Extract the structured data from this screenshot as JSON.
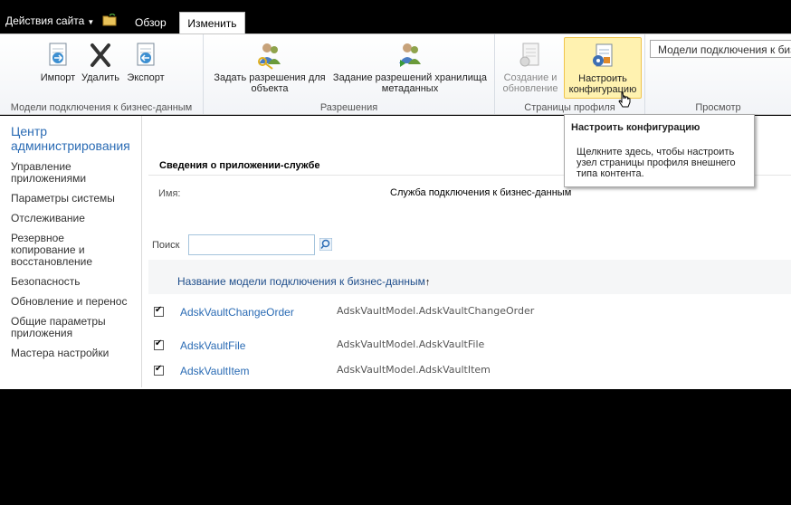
{
  "topbar": {
    "site_actions": "Действия сайта",
    "tabs": [
      {
        "label": "Обзор"
      },
      {
        "label": "Изменить"
      }
    ]
  },
  "ribbon": {
    "groups": [
      {
        "label": "Модели подключения к бизнес-данным",
        "buttons": [
          {
            "label": "Импорт",
            "icon": "import-icon"
          },
          {
            "label": "Удалить",
            "icon": "delete-icon"
          },
          {
            "label": "Экспорт",
            "icon": "export-icon"
          }
        ]
      },
      {
        "label": "Разрешения",
        "buttons": [
          {
            "line1": "Задать разрешения для",
            "line2": "объекта",
            "icon": "object-permissions-icon"
          },
          {
            "line1": "Задание разрешений хранилища",
            "line2": "метаданных",
            "icon": "metadata-store-permissions-icon"
          }
        ]
      },
      {
        "label": "Страницы профиля",
        "buttons": [
          {
            "line1": "Создание и",
            "line2": "обновление",
            "icon": "create-update-icon"
          },
          {
            "line1": "Настроить",
            "line2": "конфигурацию",
            "icon": "configure-icon"
          }
        ]
      },
      {
        "label": "Просмотр",
        "combo_value": "Модели подключения к биз"
      }
    ]
  },
  "quicklaunch": {
    "title_line1": "Центр",
    "title_line2": "администрирования",
    "items": [
      {
        "line1": "Управление",
        "line2": "приложениями"
      },
      {
        "line1": "Параметры системы"
      },
      {
        "line1": "Отслеживание"
      },
      {
        "line1": "Резервное",
        "line2": "копирование и",
        "line3": "восстановление"
      },
      {
        "line1": "Безопасность"
      },
      {
        "line1": "Обновление и перенос"
      },
      {
        "line1": "Общие параметры",
        "line2": "приложения"
      },
      {
        "line1": "Мастера настройки"
      }
    ]
  },
  "main": {
    "section_title": "Сведения о приложении-службе",
    "name_label": "Имя:",
    "name_value": "Служба подключения к бизнес-данным",
    "search_label": "Поиск",
    "search_value": "",
    "column_header": "Название модели подключения к бизнес-данным",
    "sort_arrow": "↑",
    "rows": [
      {
        "name": "AdskVaultChangeOrder",
        "value": "AdskVaultModel.AdskVaultChangeOrder",
        "checked": true
      },
      {
        "name": "AdskVaultFile",
        "value": "AdskVaultModel.AdskVaultFile",
        "checked": true
      },
      {
        "name": "AdskVaultItem",
        "value": "AdskVaultModel.AdskVaultItem",
        "checked": true
      }
    ]
  },
  "tooltip": {
    "title": "Настроить конфигурацию",
    "body_line1": "Щелкните здесь, чтобы настроить",
    "body_line2": "узел страницы профиля внешнего",
    "body_line3": "типа контента."
  },
  "colors": {
    "link": "#2a6bb4",
    "selected_button": "#fff2b0",
    "topbar": "#000000"
  }
}
